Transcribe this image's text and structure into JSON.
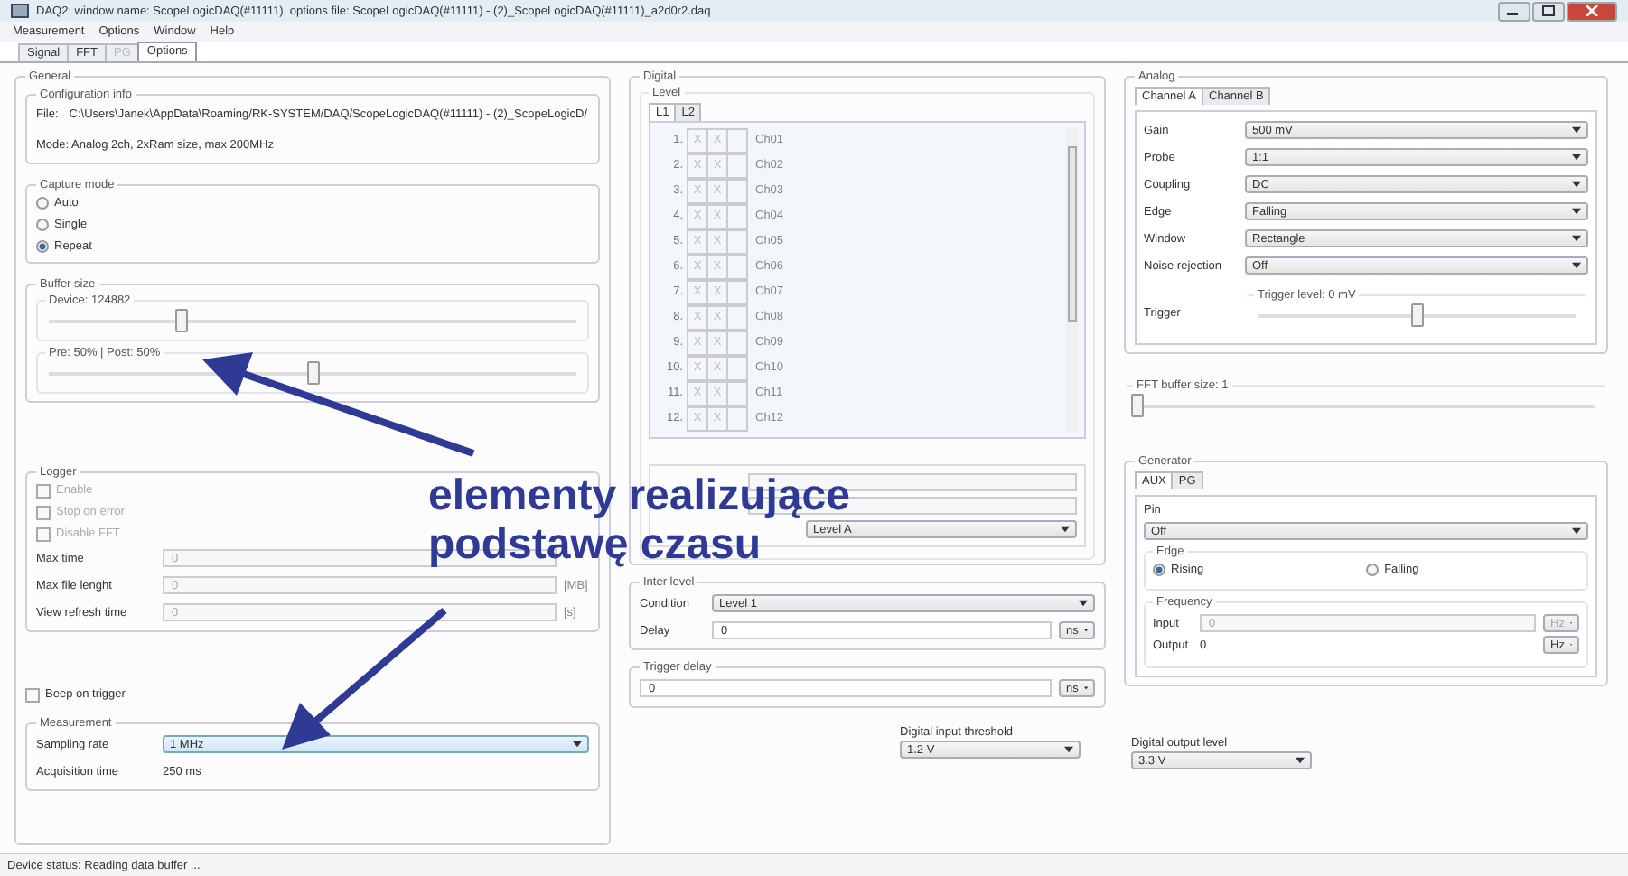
{
  "window": {
    "title": "DAQ2: window name: ScopeLogicDAQ(#11111), options file: ScopeLogicDAQ(#11111) - (2)_ScopeLogicDAQ(#11111)_a2d0r2.daq"
  },
  "menu": [
    "Measurement",
    "Options",
    "Window",
    "Help"
  ],
  "tabs": [
    {
      "label": "Signal",
      "selected": false,
      "disabled": false
    },
    {
      "label": "FFT",
      "selected": false,
      "disabled": false
    },
    {
      "label": "PG",
      "selected": false,
      "disabled": true
    },
    {
      "label": "Options",
      "selected": true,
      "disabled": false
    }
  ],
  "general": {
    "title": "General",
    "config": {
      "title": "Configuration info",
      "file_label": "File:",
      "file": "C:\\Users\\Janek\\AppData\\Roaming/RK-SYSTEM/DAQ/ScopeLogicDAQ(#11111) - (2)_ScopeLogicD/",
      "mode": "Mode: Analog 2ch, 2xRam size, max 200MHz"
    },
    "capture": {
      "title": "Capture mode",
      "options": [
        {
          "label": "Auto",
          "selected": false
        },
        {
          "label": "Single",
          "selected": false
        },
        {
          "label": "Repeat",
          "selected": true
        }
      ]
    },
    "buffer": {
      "title": "Buffer size",
      "sliders": [
        {
          "label": "Device: 124882",
          "level": 0.25
        },
        {
          "label": "Pre: 50% | Post: 50%",
          "level": 0.5
        }
      ]
    },
    "logger": {
      "title": "Logger",
      "checks": [
        {
          "label": "Enable",
          "checked": false
        },
        {
          "label": "Stop on error",
          "checked": false
        },
        {
          "label": "Disable FFT",
          "checked": false
        }
      ],
      "fields": [
        {
          "label": "Max time",
          "value": "0"
        },
        {
          "label": "Max file lenght",
          "value": "0",
          "unit": "[MB]"
        },
        {
          "label": "View refresh time",
          "value": "0",
          "unit": "[s]"
        }
      ]
    },
    "beep": {
      "label": "Beep on trigger",
      "checked": false
    },
    "measurement": {
      "title": "Measurement",
      "sampling_label": "Sampling rate",
      "sampling": "1 MHz",
      "acq_label": "Acquisition time",
      "acq": "250 ms"
    }
  },
  "digital": {
    "title": "Digital",
    "level_title": "Level",
    "tabs": [
      {
        "label": "L1",
        "selected": true
      },
      {
        "label": "L2",
        "selected": false
      }
    ],
    "channels": [
      {
        "num": "1.",
        "a": "X",
        "b": "X",
        "name": "Ch01"
      },
      {
        "num": "2.",
        "a": "X",
        "b": "X",
        "name": "Ch02"
      },
      {
        "num": "3.",
        "a": "X",
        "b": "X",
        "name": "Ch03"
      },
      {
        "num": "4.",
        "a": "X",
        "b": "X",
        "name": "Ch04"
      },
      {
        "num": "5.",
        "a": "X",
        "b": "X",
        "name": "Ch05"
      },
      {
        "num": "6.",
        "a": "X",
        "b": "X",
        "name": "Ch06"
      },
      {
        "num": "7.",
        "a": "X",
        "b": "X",
        "name": "Ch07"
      },
      {
        "num": "8.",
        "a": "X",
        "b": "X",
        "name": "Ch08"
      },
      {
        "num": "9.",
        "a": "X",
        "b": "X",
        "name": "Ch09"
      },
      {
        "num": "10.",
        "a": "X",
        "b": "X",
        "name": "Ch10"
      },
      {
        "num": "11.",
        "a": "X",
        "b": "X",
        "name": "Ch11"
      },
      {
        "num": "12.",
        "a": "X",
        "b": "X",
        "name": "Ch12"
      }
    ],
    "level_select": "Level A",
    "inter": {
      "title": "Inter level",
      "condition_label": "Condition",
      "condition": "Level 1",
      "delay_label": "Delay",
      "delay": "0",
      "delay_unit": "ns"
    },
    "trigger_delay": {
      "title": "Trigger delay",
      "value": "0",
      "unit": "ns"
    },
    "threshold": {
      "label": "Digital input threshold",
      "value": "1.2 V"
    }
  },
  "analog": {
    "title": "Analog",
    "tabs": [
      {
        "label": "Channel A",
        "selected": true
      },
      {
        "label": "Channel B",
        "selected": false
      }
    ],
    "settings": [
      {
        "label": "Gain",
        "value": "500 mV"
      },
      {
        "label": "Probe",
        "value": "1:1"
      },
      {
        "label": "Coupling",
        "value": "DC"
      },
      {
        "label": "Edge",
        "value": "Falling"
      },
      {
        "label": "Window",
        "value": "Rectangle"
      },
      {
        "label": "Noise rejection",
        "value": "Off"
      }
    ],
    "trigger_label": "Trigger",
    "trigger_slider": {
      "label": "Trigger level: 0 mV",
      "level": 0.5
    }
  },
  "fft": {
    "label": "FFT buffer size: 1",
    "level": 0
  },
  "generator": {
    "title": "Generator",
    "tabs": [
      {
        "label": "AUX",
        "selected": true
      },
      {
        "label": "PG",
        "selected": false
      }
    ],
    "pin_label": "Pin",
    "pin": "Off",
    "edge_label": "Edge",
    "edges": [
      {
        "label": "Rising",
        "selected": true
      },
      {
        "label": "Falling",
        "selected": false
      }
    ],
    "frequency": {
      "title": "Frequency",
      "input_label": "Input",
      "input": "0",
      "input_unit": "Hz",
      "output_label": "Output",
      "output": "0",
      "output_unit": "Hz"
    }
  },
  "output_level": {
    "label": "Digital output level",
    "value": "3.3 V"
  },
  "status": "Device status: Reading data buffer ...",
  "annotation": [
    "elementy realizujące",
    "podstawę czasu"
  ]
}
